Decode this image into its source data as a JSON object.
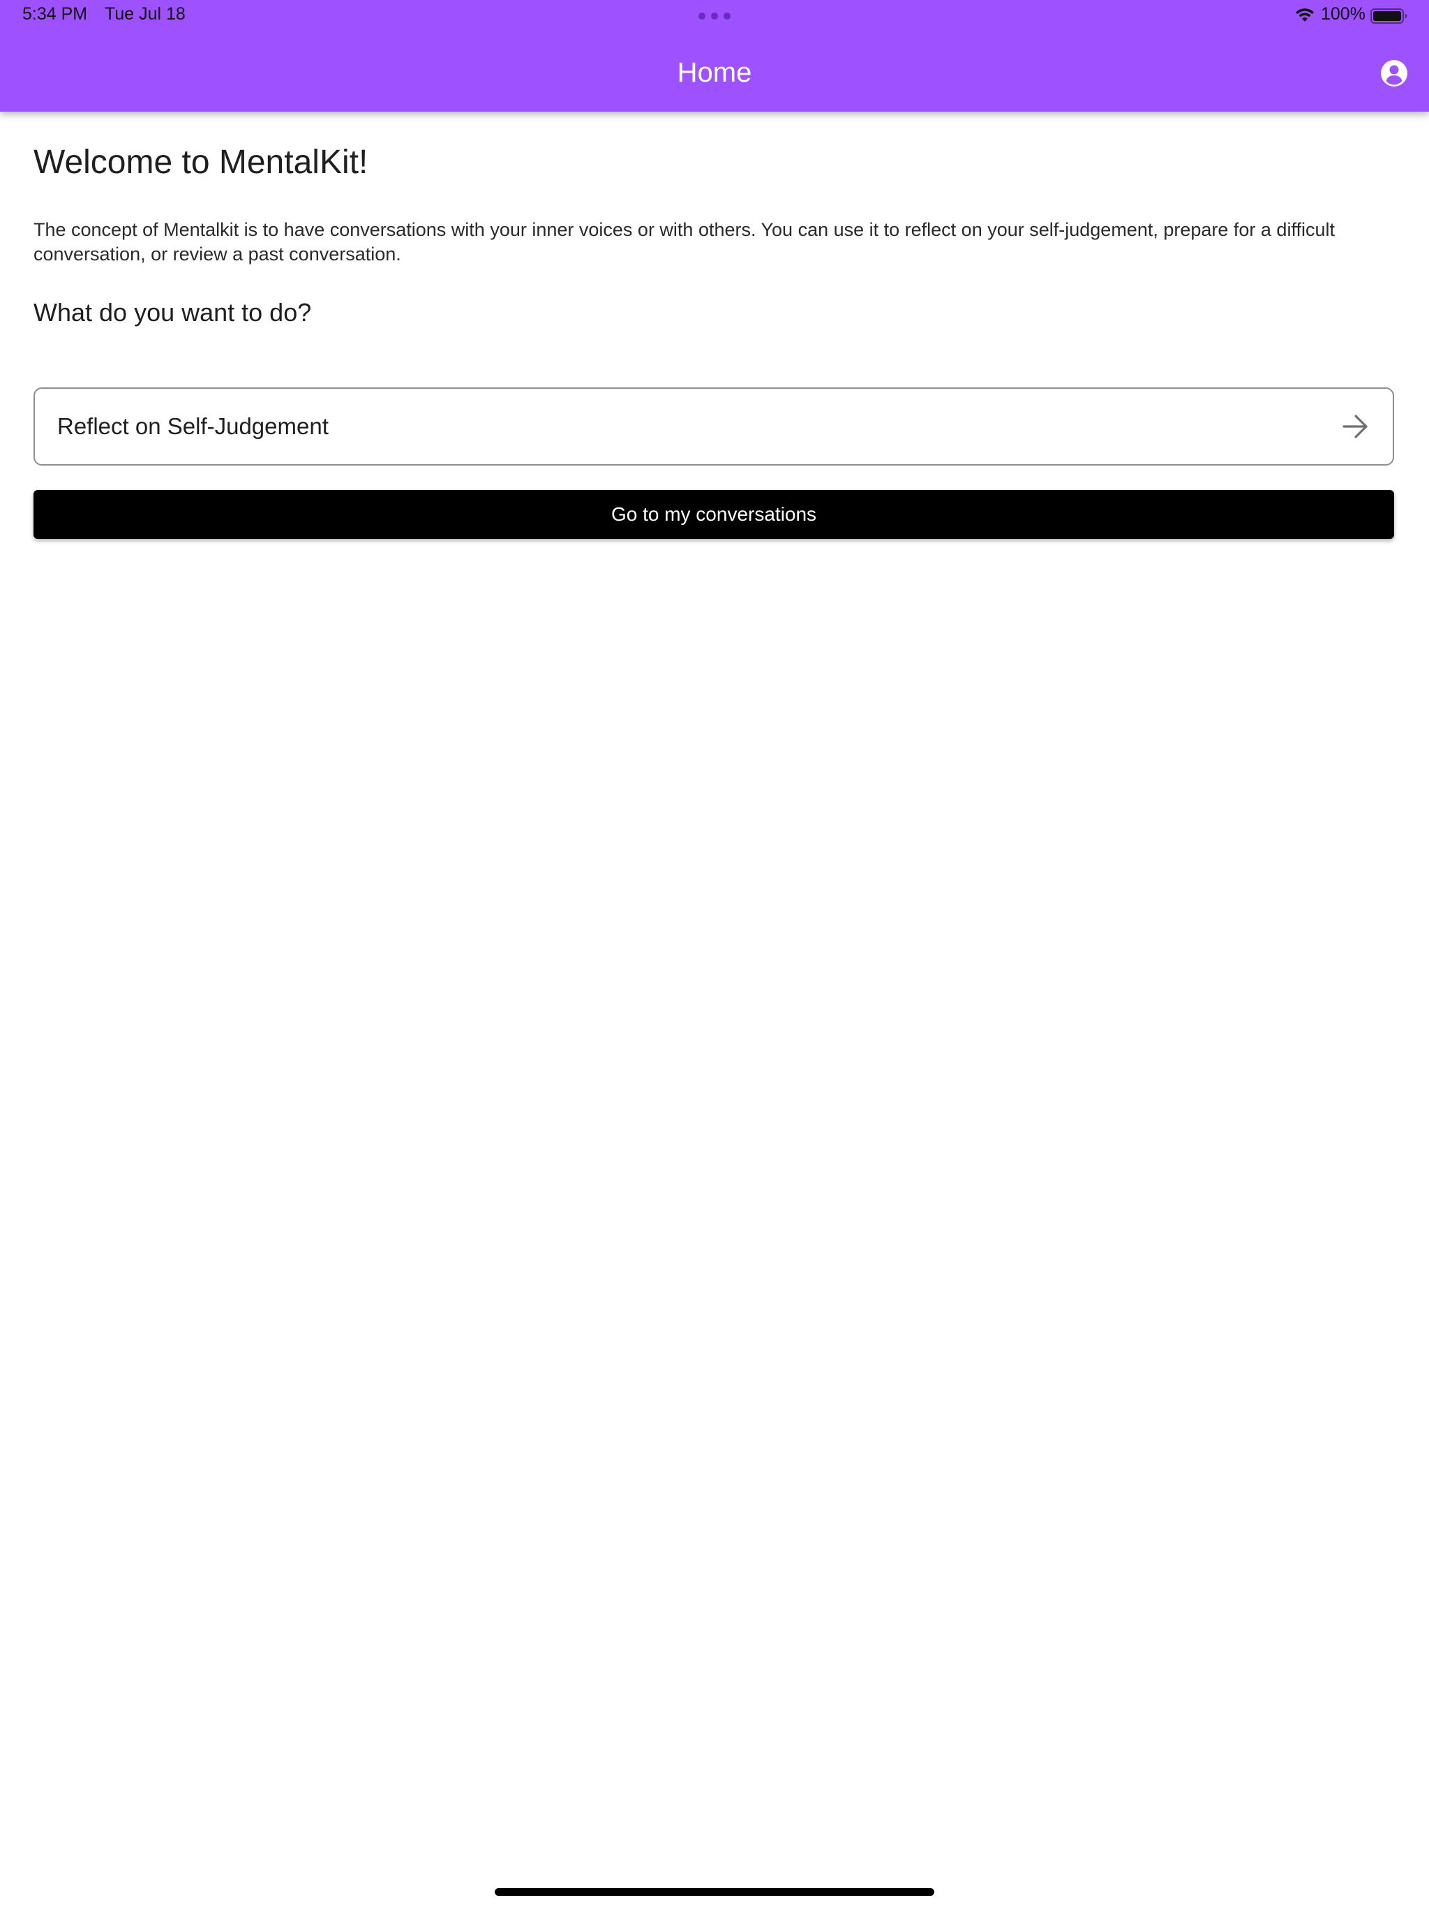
{
  "status_bar": {
    "time": "5:34 PM",
    "date": "Tue Jul 18",
    "battery": "100%",
    "icons": [
      "wifi-icon",
      "battery-icon",
      "multitask-dots-icon"
    ]
  },
  "app_bar": {
    "title": "Home",
    "profile_icon": "account-circle-icon",
    "color": "#9e52ff"
  },
  "main": {
    "title": "Welcome to MentalKit!",
    "intro": "The concept of Mentalkit is to have conversations with your inner voices or with others. You can use it to reflect on your self-judgement, prepare for a difficult conversation, or review a past conversation.",
    "question": "What do you want to do?",
    "options": [
      {
        "label": "Reflect on Self-Judgement",
        "icon": "arrow-right-icon"
      }
    ],
    "conversations_button": "Go to my conversations"
  }
}
